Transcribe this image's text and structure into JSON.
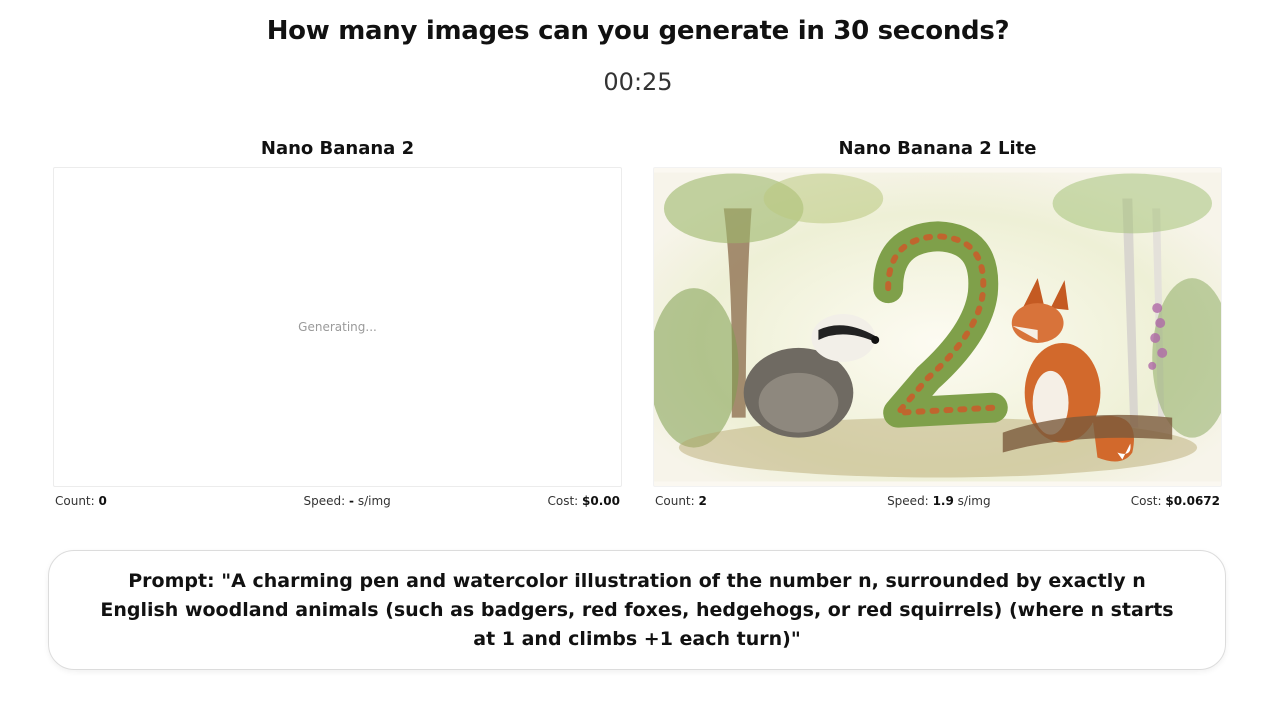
{
  "header": {
    "title": "How many images can you generate in 30 seconds?",
    "timer": "00:25"
  },
  "panels": [
    {
      "name": "Nano Banana 2",
      "status": "Generating...",
      "count_label": "Count:",
      "count_value": "0",
      "speed_label": "Speed:",
      "speed_value": "-",
      "speed_unit": "s/img",
      "cost_label": "Cost:",
      "cost_value": "$0.00"
    },
    {
      "name": "Nano Banana 2 Lite",
      "image": "watercolor illustration of the number 2 with a badger and a red fox in a forest",
      "count_label": "Count:",
      "count_value": "2",
      "speed_label": "Speed:",
      "speed_value": "1.9",
      "speed_unit": "s/img",
      "cost_label": "Cost:",
      "cost_value": "$0.0672"
    }
  ],
  "prompt": {
    "text": "Prompt: \"A charming pen and watercolor illustration of the number n, surrounded by exactly n English woodland animals (such as badgers, red foxes, hedgehogs, or red squirrels) (where n starts at 1 and climbs +1 each turn)\""
  },
  "colors": {
    "fox": "#d2692c",
    "moss": "#7fa04a",
    "paper": "#fbf8f1"
  }
}
